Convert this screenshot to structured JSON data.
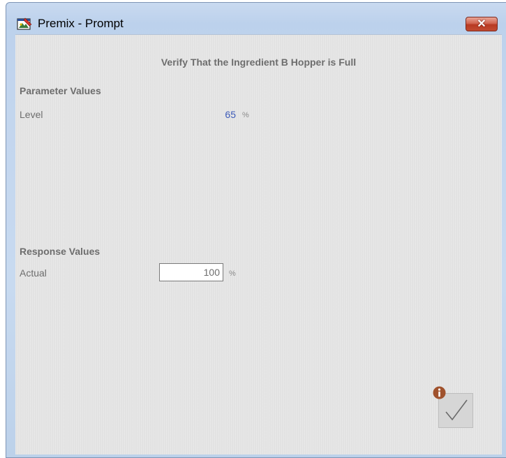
{
  "window": {
    "title": "Premix - Prompt",
    "close_symbol": "✕",
    "app_icon": "premix-app-icon"
  },
  "prompt": {
    "title": "Verify That the Ingredient B Hopper is Full"
  },
  "parameters": {
    "heading": "Parameter Values",
    "items": [
      {
        "label": "Level",
        "value": "65",
        "unit": "%"
      }
    ]
  },
  "responses": {
    "heading": "Response Values",
    "items": [
      {
        "label": "Actual",
        "value": "100",
        "unit": "%"
      }
    ]
  },
  "actions": {
    "confirm_icon": "checkmark-icon",
    "info_icon": "info-icon"
  },
  "colors": {
    "parameter_value": "#3d5bb8",
    "close_button": "#c24a30",
    "info_badge": "#a0522d"
  }
}
